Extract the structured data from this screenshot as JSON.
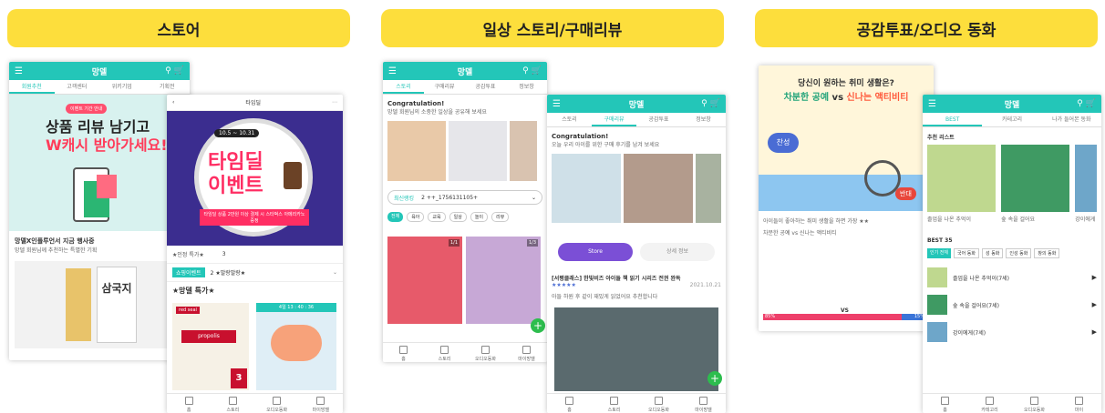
{
  "headers": {
    "store": "스토어",
    "story": "일상 스토리/구매리뷰",
    "vote": "공감투표/오디오 동화"
  },
  "brand": "망델",
  "menu_icon": "☰",
  "header_icons": "⚲ 🛒",
  "store_back": {
    "tabs": [
      "회원추천",
      "고객센터",
      "위키기업",
      "기획전"
    ],
    "banner_badge": "이벤트 기간 안내",
    "banner_line1": "상품 리뷰 남기고",
    "banner_line2": "W캐시 받아가세요!",
    "section_title": "망델X인플루언서 지금 행사중",
    "section_sub": "망델 회원님께 추천하는 특별한 기획",
    "book_title": "삼국지"
  },
  "store_front": {
    "title": "타임딜",
    "event_date": "10.5 ~ 10.31",
    "event_line1": "타임딜",
    "event_line2": "이벤트",
    "event_desc": "타임딜 상품 2만원 이상 결제 시 스타벅스 아메리카노 증정",
    "row1_label": "★인정 특가★",
    "row1_val": "3",
    "row2_label": "쇼핑이벤트",
    "row2_val": "2 ★말랑말랑★",
    "special_title": "★망델 특가★",
    "timer": "4일 13 : 40 : 36",
    "promo_tag": "red seal",
    "promo_name": "propolis",
    "sale_num": "3"
  },
  "story_back": {
    "tabs": [
      "스토리",
      "구매리뷰",
      "공감투표",
      "정보창"
    ],
    "congrats": "Congratulation!",
    "congrats_sub": "망델 회원님의 소중한 일상을 공유해 보세요",
    "select_label": "최신랭킹",
    "select_value": "2 ++_1756131105+",
    "filters": [
      "전체",
      "육아",
      "교육",
      "일상",
      "놀이",
      "리뷰"
    ],
    "card_count1": "1/1",
    "card_count2": "1/3",
    "fab": "+",
    "nav": [
      "홈",
      "스토리",
      "오디오동화",
      "마이망델"
    ]
  },
  "story_front": {
    "tabs": [
      "스토리",
      "구매리뷰",
      "공감투표",
      "정보창"
    ],
    "congrats": "Congratulation!",
    "congrats_sub": "오늘 우리 아이를 위한 구매 후기를 남겨 보세요",
    "store_btn": "Store",
    "other_btn": "상세 정보",
    "review_title": "[서평클래스] 한빛비즈 아이들 책 읽기 시리즈 전권 완독",
    "review_stars": "★★★★★",
    "review_text": "아들 하원 후 같이 재밌게 읽었어요 추천합니다",
    "review_date": "2021.10.21",
    "fab": "+",
    "nav": [
      "홈",
      "스토리",
      "오디오동화",
      "마이망델"
    ]
  },
  "vote_back": {
    "question": "당신이 원하는 취미 생활은?",
    "opt_a": "차분한 공예",
    "vs": "vs",
    "opt_b": "신나는 액티비티",
    "sticker_a": "찬성",
    "sticker_b": "반대",
    "desc1": "아이들이 좋아하는 취미 생활을 하면 가장 ★★",
    "desc2": "차분한 공예 vs 신나는 액티비티",
    "bar_vs": "VS",
    "pct_a": "85%",
    "pct_b": "15%"
  },
  "vote_front": {
    "tabs": [
      "BEST",
      "카테고리",
      "나가 들어본 동화"
    ],
    "rec_title": "추천 리스트",
    "rec_books": [
      "졸업을 나온 추억이",
      "숲 속을 걸어요",
      "강이에게"
    ],
    "best_title": "BEST 35",
    "chips": [
      "인기 전체",
      "국어 동화",
      "성 동화",
      "인성 동화",
      "창의 동화"
    ],
    "best_items": [
      "졸업을 나온 추억이(7세)",
      "숲 속을 걸어요(7세)",
      "강이에게(7세)"
    ],
    "nav": [
      "홈",
      "카테고리",
      "오디오동화",
      "마이"
    ]
  }
}
